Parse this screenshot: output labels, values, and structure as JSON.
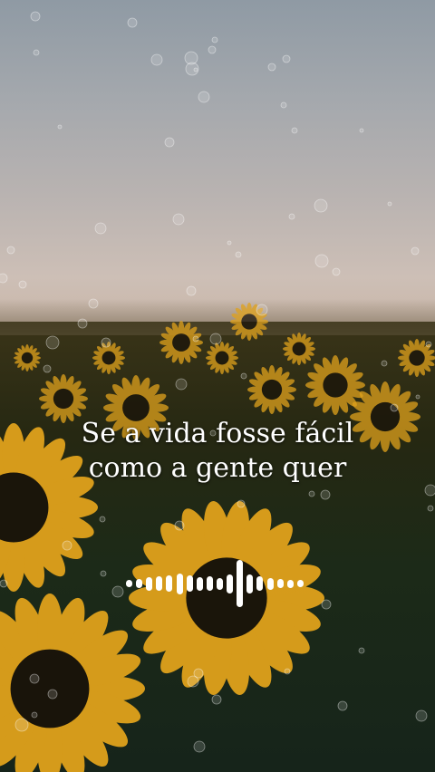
{
  "caption": {
    "line1": "Se a vida fosse fácil",
    "line2": "como a gente quer"
  },
  "waveform": {
    "bar_levels": [
      0.15,
      0.2,
      0.28,
      0.3,
      0.35,
      0.45,
      0.35,
      0.28,
      0.3,
      0.25,
      0.4,
      1.0,
      0.4,
      0.3,
      0.25,
      0.2,
      0.18,
      0.15
    ]
  },
  "scene": {
    "subject": "sunflower field at dusk",
    "petal_color": "#e0a21c",
    "center_color": "#1a140a",
    "text_color": "#ffffff"
  }
}
